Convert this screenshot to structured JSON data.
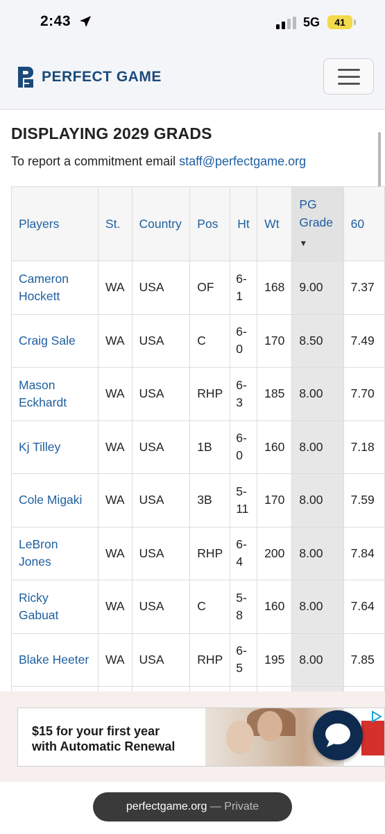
{
  "status_bar": {
    "time": "2:43",
    "network": "5G",
    "battery_level": "41"
  },
  "header": {
    "logo_text": "PERFECT GAME"
  },
  "page": {
    "title": "DISPLAYING 2029 GRADS",
    "report_text": "To report a commitment email ",
    "report_email": "staff@perfectgame.org"
  },
  "table": {
    "columns": [
      {
        "key": "player",
        "label": "Players"
      },
      {
        "key": "state",
        "label": "St."
      },
      {
        "key": "country",
        "label": "Country"
      },
      {
        "key": "pos",
        "label": "Pos"
      },
      {
        "key": "ht",
        "label": "Ht"
      },
      {
        "key": "wt",
        "label": "Wt"
      },
      {
        "key": "grade",
        "label": "PG Grade"
      },
      {
        "key": "sixty",
        "label": "60"
      }
    ],
    "sort_indicator": "▼",
    "rows": [
      {
        "player": "Cameron Hockett",
        "state": "WA",
        "country": "USA",
        "pos": "OF",
        "ht": "6-1",
        "wt": "168",
        "grade": "9.00",
        "sixty": "7.37"
      },
      {
        "player": "Craig Sale",
        "state": "WA",
        "country": "USA",
        "pos": "C",
        "ht": "6-0",
        "wt": "170",
        "grade": "8.50",
        "sixty": "7.49"
      },
      {
        "player": "Mason Eckhardt",
        "state": "WA",
        "country": "USA",
        "pos": "RHP",
        "ht": "6-3",
        "wt": "185",
        "grade": "8.00",
        "sixty": "7.70"
      },
      {
        "player": "Kj Tilley",
        "state": "WA",
        "country": "USA",
        "pos": "1B",
        "ht": "6-0",
        "wt": "160",
        "grade": "8.00",
        "sixty": "7.18"
      },
      {
        "player": "Cole Migaki",
        "state": "WA",
        "country": "USA",
        "pos": "3B",
        "ht": "5-11",
        "wt": "170",
        "grade": "8.00",
        "sixty": "7.59"
      },
      {
        "player": "LeBron Jones",
        "state": "WA",
        "country": "USA",
        "pos": "RHP",
        "ht": "6-4",
        "wt": "200",
        "grade": "8.00",
        "sixty": "7.84"
      },
      {
        "player": "Ricky Gabuat",
        "state": "WA",
        "country": "USA",
        "pos": "C",
        "ht": "5-8",
        "wt": "160",
        "grade": "8.00",
        "sixty": "7.64"
      },
      {
        "player": "Blake Heeter",
        "state": "WA",
        "country": "USA",
        "pos": "RHP",
        "ht": "6-5",
        "wt": "195",
        "grade": "8.00",
        "sixty": "7.85"
      },
      {
        "player": "",
        "state": "",
        "country": "",
        "pos": "",
        "ht": "",
        "wt": "",
        "grade": "",
        "sixty": ""
      }
    ]
  },
  "ad": {
    "line1": "$15 for your first year",
    "line2": "with Automatic Renewal"
  },
  "url_bar": {
    "host": "perfectgame.org",
    "suffix": " — Private"
  },
  "colors": {
    "link": "#1f5fa0",
    "brand": "#1b4a7a",
    "sorted_column": "#e7e7e7",
    "chat_button": "#0f2a4f",
    "battery": "#f3d94c"
  }
}
